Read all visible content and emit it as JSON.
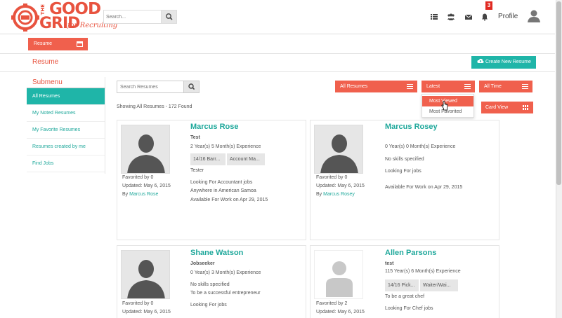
{
  "brand": {
    "the": "THE",
    "good": "GOOD",
    "grid": "GRID",
    "tagline": "for Recruiting",
    "accent": "#e8533f",
    "teal": "#1fb5a8"
  },
  "header": {
    "search_placeholder": "Search...",
    "notification_count": "3",
    "profile_label": "Profile",
    "icons": [
      "list-icon",
      "group-icon",
      "envelope-icon",
      "bell-icon",
      "user-avatar-icon"
    ]
  },
  "toolbar": {
    "resume_button": "Resume",
    "page_title": "Resume",
    "create_button": "Create New Resume"
  },
  "sidebar": {
    "title": "Submenu",
    "items": [
      {
        "label": "All Resumes",
        "active": true
      },
      {
        "label": "My Noted Resumes",
        "active": false
      },
      {
        "label": "My Favorite Resumes",
        "active": false
      },
      {
        "label": "Resumes created by me",
        "active": false
      },
      {
        "label": "Find Jobs",
        "active": false
      }
    ]
  },
  "filters": {
    "search_placeholder": "Search Resumes",
    "all_resumes": "All Resumes",
    "sort": "Latest",
    "time": "All Time",
    "view": "Card View",
    "sort_options": [
      "Most Viewed",
      "Most Favorited"
    ],
    "showing": "Showing All Resumes - 172 Found"
  },
  "cards": [
    {
      "name": "Marcus Rose",
      "title": "Test",
      "experience": "2 Year(s) 5 Month(s) Experience",
      "tags": [
        "14/16 Barr...",
        "Account Ma..."
      ],
      "lines": [
        "Tester",
        "Looking For Accountant jobs",
        "Anywhere in American Samoa",
        "Available For Work on Apr 29, 2015"
      ],
      "favorited": "Favorited by 0",
      "updated": "Updated: May 6, 2015",
      "by_prefix": "By",
      "by_name": "Marcus Rose"
    },
    {
      "name": "Marcus Rosey",
      "title": "",
      "experience": "0 Year(s) 0 Month(s) Experience",
      "tags": [],
      "lines": [
        "No skills specified",
        "Looking For jobs",
        "Available For Work on Apr 29, 2015"
      ],
      "favorited": "Favorited by 0",
      "updated": "Updated: May 6, 2015",
      "by_prefix": "By",
      "by_name": "Marcus Rosey"
    },
    {
      "name": "Shane Watson",
      "title": "Jobseeker",
      "experience": "0 Year(s) 3 Month(s) Experience",
      "tags": [],
      "lines": [
        "No skills specified",
        "To be a successful entrepreneur",
        "Looking For jobs"
      ],
      "favorited": "Favorited by 0",
      "updated": "Updated: May 6, 2015"
    },
    {
      "name": "Allen Parsons",
      "title": "test",
      "experience": "115 Year(s) 6 Month(s) Experience",
      "tags": [
        "14/16 Pick...",
        "Waiter/Wai..."
      ],
      "lines": [
        "To be a great chef",
        "Looking For Chef jobs"
      ],
      "favorited": "Favorited by 2",
      "updated": "Updated: May 6, 2015"
    }
  ]
}
